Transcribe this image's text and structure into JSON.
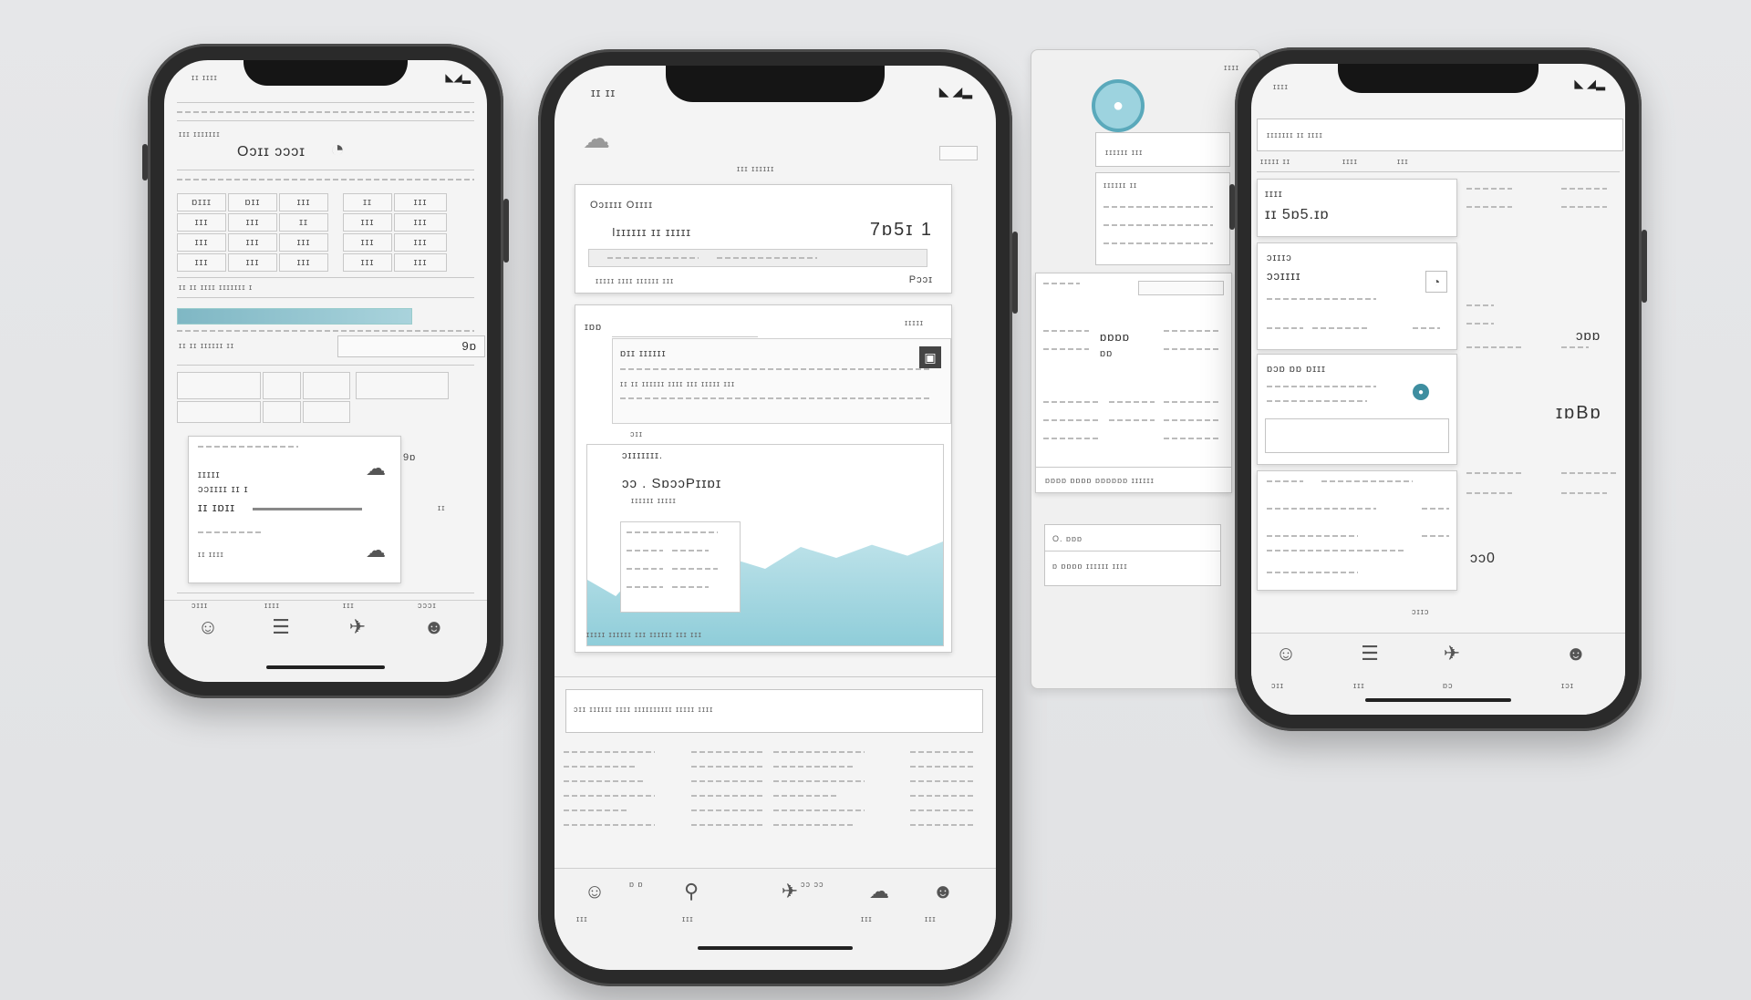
{
  "phone_left": {
    "status_left": "ɪɪ ɪɪɪɪ",
    "header_label": "ɪɪɪ ɪɪɪɪɪɪɪ",
    "title": "Oɔɪɪ ɔɔɔɪ",
    "row_labels": [
      "ɪɪɪɪ ɪɪɪ",
      "ɪɪ ɪɪɪ",
      "ɪɪɪ ɪɪ"
    ],
    "grid": [
      [
        "ɒɪɪɪ",
        "ɒɪɪ",
        "ɪɪɪ",
        "ɪɪ",
        "ɪɪɪ"
      ],
      [
        "ɪɪɪ",
        "ɪɪɪ",
        "ɪɪ",
        "ɪɪɪ",
        "ɪɪɪ"
      ],
      [
        "ɪɪɪ",
        "ɪɪɪ",
        "ɪɪɪ",
        "ɪɪɪ",
        "ɪɪɪ"
      ],
      [
        "ɪɪɪ",
        "ɪɪɪ",
        "ɪɪɪ",
        "ɪɪɪ",
        "ɪɪɪ"
      ]
    ],
    "footer_row": "ɪɪ ɪɪ ɪɪɪɪ ɪɪɪɪɪɪɪ ɪ",
    "section2_label": "ɪɪ ɪɪ ɪɪɪɪɪɪ ɪɪ",
    "section2_value": "9ɒ",
    "popup": {
      "line1": "ɪɪɪɪɪ",
      "line2": "ɔɔɪɪɪɪ ɪɪ ɪ",
      "line3": "ɪɪ ɪɒɪɪ",
      "line4": "ɪɪ ɪɪɪɪ"
    },
    "tab_labels": [
      "ɔɪɪɪ",
      "ɪɪɪɪ",
      "ɪɪɪ",
      "ɔɔɔɪ"
    ]
  },
  "phone_center": {
    "status_left": "ɪɪ ɪɪ",
    "header_label": "ɪɪɪ ɪɪɪɪɪɪ",
    "card1": {
      "title": "Oɔɪɪɪɪ Oɪɪɪɪ",
      "subtitle": "Iɪɪɪɪɪɪ ɪɪ ɪɪɪɪɪ",
      "amount": "7ɒ5ɪ 1",
      "footer_left": "ɪɪɪɪɪ ɪɪɪɪ ɪɪɪɪɪɪ ɪɪɪ",
      "footer_right": "Pɔɔɪ"
    },
    "card2": {
      "header": "ɪɒɒ",
      "corner": "ɪɪɪɪɪ",
      "row_title": "ɒɪɪ ɪɪɪɪɪɪ",
      "row_text": "ɪɪ ɪɪ ɪɪɪɪɪɪ ɪɪɪɪ ɪɪɪ ɪɪɪɪɪ ɪɪɪ",
      "panel_label": "ɔɪɪ",
      "inner_title": "ɔɪɪɪɪɪɪɪ.",
      "inner_value": "ɔɔ . SɒɔɔPɪɪɒɪ",
      "inner_sub": "ɪɪɪɪɪɪ ɪɪɪɪɪ",
      "bottom_text": "ɪɪɪɪɪ ɪɪɪɪɪɪ ɪɪɪ ɪɪɪɪɪɪ ɪɪɪ ɪɪɪ"
    },
    "banner_text": "ɔɪɪ ɪɪɪɪɪɪ ɪɪɪɪ ɪɪɪɪɪɪɪɪɪɪ ɪɪɪɪɪ ɪɪɪɪ",
    "tab_labels": [
      "ɪɪɪ",
      "ɒ ɒ",
      "ɪɪɪ",
      "ɔɔ ɔɔ",
      "ɪɪɪ",
      "ɪɪɪ"
    ]
  },
  "panel_middle": {
    "header": "ɪɪɪɪ",
    "title1": "ɪɪɪɪɪɪ ɪɪɪ",
    "title2": "ɪɪɪɪɪɪ ɪɪ",
    "label": "ɒɒɒɒ",
    "value": "ɒɒ",
    "footer": "ɒɒɒɒ ɒɒɒɒ ɒɒɒɒɒɒ ɪɪɪɪɪɪ",
    "bottom1": "O. ɒɒɒ",
    "bottom2": "ɒ ɒɒɒɒ ɪɪɪɪɪɪ ɪɪɪɪ"
  },
  "phone_right": {
    "header_line": "ɪɪɪɪɪɪɪ ɪɪ ɪɪɪɪ",
    "tab1": "ɪɪɪɪɪ ɪɪ",
    "tab2": "ɪɪɪɪ",
    "tab3": "ɪɪɪ",
    "card_amount": "ɪɪ 5ɒ5.ɪɒ",
    "card_label": "ɪɪɪɪ",
    "card2_title": "ɔɪɪɪɔ",
    "card2_sub": "ɔɔɪɪɪɪ",
    "card3_title": "ɒɔɒ ɒɒ ɒɪɪɪ",
    "right_big": "ɪɒBɒ",
    "right_small": "ɔɒɒ",
    "bottom_value": "ɔɔ0",
    "bottom_label": "ɔɪɪɔ",
    "tab_labels": [
      "ɔɪɪ",
      "ɪɪɪ",
      "ɒɔ",
      "ɪɔɪ"
    ]
  },
  "colors": {
    "accent": "#7fc6d4",
    "accent_dark": "#5aa9bb",
    "teal": "#3e8ea0"
  }
}
